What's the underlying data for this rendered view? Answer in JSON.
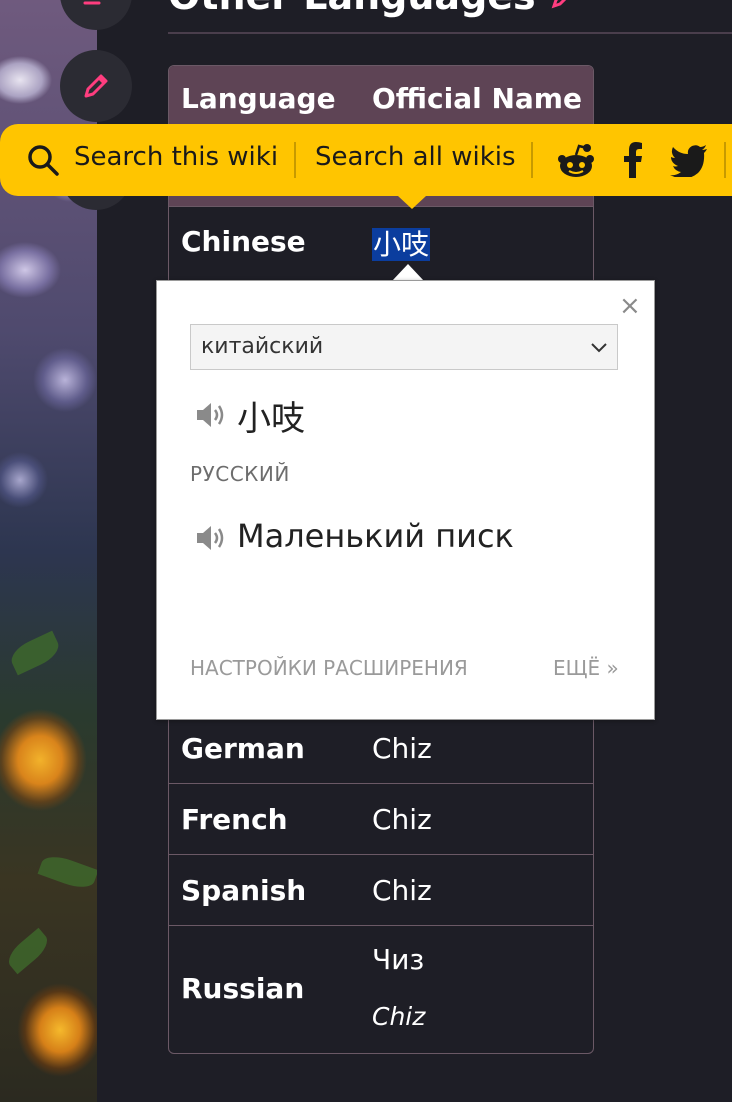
{
  "header": {
    "title": "Other Languages"
  },
  "search_bar": {
    "search_this_wiki": "Search this wiki",
    "search_all_wikis": "Search all wikis",
    "social_icons": [
      "reddit-icon",
      "facebook-icon",
      "twitter-icon"
    ]
  },
  "table": {
    "headers": {
      "language": "Language",
      "official_name": "Official Name"
    },
    "rows": [
      {
        "language": "Chinese",
        "name": "小吱"
      },
      {
        "language": "German",
        "name": "Chiz"
      },
      {
        "language": "French",
        "name": "Chiz"
      },
      {
        "language": "Spanish",
        "name": "Chiz"
      },
      {
        "language": "Russian",
        "name": "Чиз",
        "name_translit": "Chiz"
      }
    ]
  },
  "popup": {
    "close": "×",
    "source_language": "китайский",
    "source_text": "小吱",
    "target_language": "РУССКИЙ",
    "target_text": "Маленький писк",
    "settings_link": "НАСТРОЙКИ РАСШИРЕНИЯ",
    "more_link": "ЕЩЁ »"
  },
  "colors": {
    "page_bg": "#1e1e26",
    "table_header_bg": "#5e4455",
    "search_bar_bg": "#ffc500",
    "accent_pink": "#ff3d7f",
    "selection_bg": "#0b3d9e"
  }
}
